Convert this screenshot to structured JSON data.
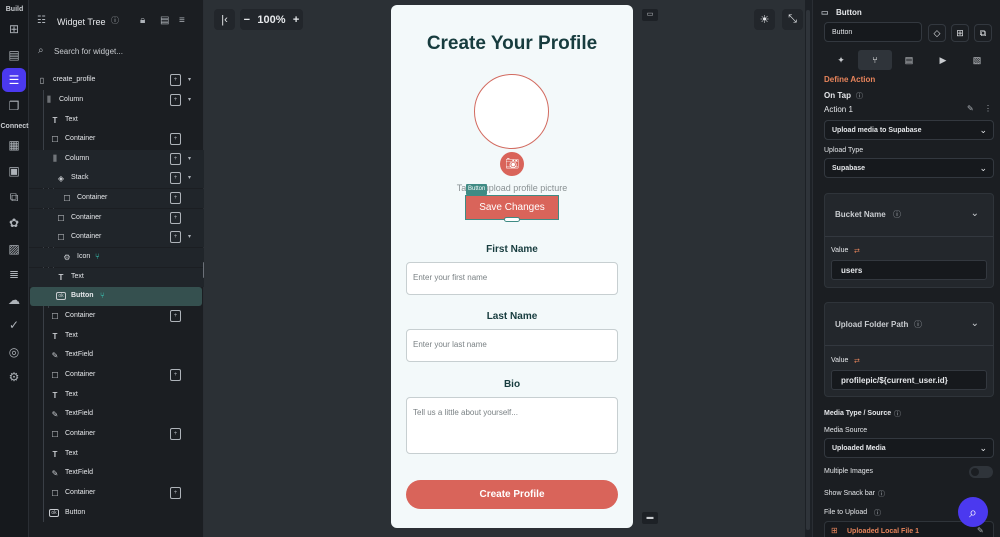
{
  "rail": {
    "build_label": "Build",
    "connect_label": "Connect",
    "icons": [
      "add-page-icon",
      "pages-icon",
      "widget-tree-icon",
      "components-icon",
      "database-icon",
      "storyboard-icon",
      "api-icon",
      "theme-icon",
      "media-icon",
      "localization-icon",
      "cloud-icon",
      "agents-icon",
      "integrations-icon",
      "settings-icon"
    ]
  },
  "tree": {
    "title": "Widget Tree",
    "search_placeholder": "Search for widget...",
    "items": [
      {
        "label": "create_profile",
        "kind": "page"
      },
      {
        "label": "Column",
        "kind": "column"
      },
      {
        "label": "Text",
        "kind": "text"
      },
      {
        "label": "Container",
        "kind": "container"
      },
      {
        "label": "Column",
        "kind": "column"
      },
      {
        "label": "Stack",
        "kind": "stack"
      },
      {
        "label": "Container",
        "kind": "container"
      },
      {
        "label": "Container",
        "kind": "container"
      },
      {
        "label": "Container",
        "kind": "container"
      },
      {
        "label": "Icon",
        "kind": "icon"
      },
      {
        "label": "Text",
        "kind": "text"
      },
      {
        "label": "Button",
        "kind": "button"
      },
      {
        "label": "Container",
        "kind": "container"
      },
      {
        "label": "Text",
        "kind": "text"
      },
      {
        "label": "TextField",
        "kind": "textfield"
      },
      {
        "label": "Container",
        "kind": "container"
      },
      {
        "label": "Text",
        "kind": "text"
      },
      {
        "label": "TextField",
        "kind": "textfield"
      },
      {
        "label": "Container",
        "kind": "container"
      },
      {
        "label": "Text",
        "kind": "text"
      },
      {
        "label": "TextField",
        "kind": "textfield"
      },
      {
        "label": "Container",
        "kind": "container"
      },
      {
        "label": "Button",
        "kind": "button"
      }
    ]
  },
  "canvas": {
    "zoom": "100%",
    "phone": {
      "title": "Create Your Profile",
      "upload_text": "Tap to upload profile picture",
      "selected_badge": "Button",
      "save_button": "Save Changes",
      "first_name_label": "First Name",
      "first_name_placeholder": "Enter your first name",
      "last_name_label": "Last Name",
      "last_name_placeholder": "Enter your last name",
      "bio_label": "Bio",
      "bio_placeholder": "Tell us a little about yourself...",
      "create_button": "Create Profile"
    }
  },
  "props": {
    "widget_type": "Button",
    "widget_name": "Button",
    "section_title": "Define Action",
    "on_tap": "On Tap",
    "action_name": "Action 1",
    "action_select": "Upload media to Supabase",
    "upload_type_label": "Upload Type",
    "upload_type": "Supabase",
    "bucket_name_title": "Bucket Name",
    "bucket_value_label": "Value",
    "bucket_value": "users",
    "folder_path_title": "Upload Folder Path",
    "folder_value_label": "Value",
    "folder_value": "profilepic/${current_user.id}",
    "media_type_title": "Media Type / Source",
    "media_source_label": "Media Source",
    "media_source": "Uploaded Media",
    "multiple_images_label": "Multiple Images",
    "snackbar_label": "Show Snack bar",
    "file_to_upload_label": "File to Upload",
    "file_to_upload": "Uploaded Local File 1"
  },
  "colors": {
    "accent": "#4b39ef",
    "brand_coral": "#d9645a",
    "heading_dark": "#173c3e",
    "teal": "#39d2c0",
    "orange": "#e8845b"
  }
}
